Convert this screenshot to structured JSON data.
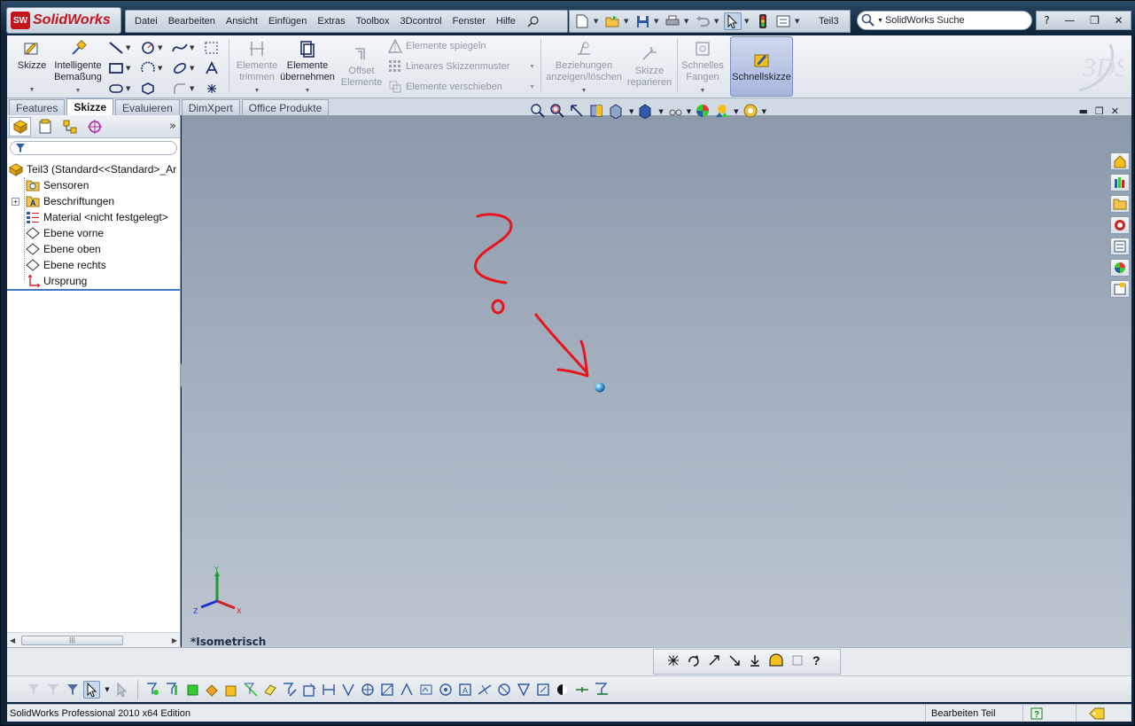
{
  "app": {
    "logo_badge": "SW",
    "logo_text": "SolidWorks",
    "document_title": "Teil3"
  },
  "menu": [
    "Datei",
    "Bearbeiten",
    "Ansicht",
    "Einfügen",
    "Extras",
    "Toolbox",
    "3Dcontrol",
    "Fenster",
    "Hilfe"
  ],
  "search": {
    "placeholder": "SolidWorks Suche"
  },
  "window_buttons": {
    "help": "?",
    "minimize": "—",
    "restore": "❐",
    "close": "✕"
  },
  "ribbon": {
    "skizze": "Skizze",
    "bemassung_1": "Intelligente",
    "bemassung_2": "Bemaßung",
    "trimmen_1": "Elemente",
    "trimmen_2": "trimmen",
    "uebernehmen_1": "Elemente",
    "uebernehmen_2": "übernehmen",
    "offset_1": "Offset",
    "offset_2": "Elemente",
    "spiegeln": "Elemente spiegeln",
    "muster": "Lineares Skizzenmuster",
    "verschieben": "Elemente verschieben",
    "beziehungen_1": "Beziehungen",
    "beziehungen_2": "anzeigen/löschen",
    "reparieren_1": "Skizze",
    "reparieren_2": "reparieren",
    "fangen_1": "Schnelles",
    "fangen_2": "Fangen",
    "schnellskizze": "Schnellskizze"
  },
  "tabs": [
    "Features",
    "Skizze",
    "Evaluieren",
    "DimXpert",
    "Office Produkte"
  ],
  "active_tab": "Skizze",
  "tree": {
    "root": "Teil3  (Standard<<Standard>_Ar",
    "items": [
      "Sensoren",
      "Beschriftungen",
      "Material <nicht festgelegt>",
      "Ebene vorne",
      "Ebene oben",
      "Ebene rechts",
      "Ursprung"
    ]
  },
  "viewport": {
    "orientation": "*Isometrisch",
    "background_top": "#8b99ab",
    "background_bottom": "#bdc6d1",
    "annotation_color": "#e8141e",
    "triad": {
      "x": "X",
      "y": "Y",
      "z": "Z"
    }
  },
  "status": {
    "edition": "SolidWorks Professional 2010 x64 Edition",
    "mode": "Bearbeiten Teil",
    "help_icon": "?"
  }
}
